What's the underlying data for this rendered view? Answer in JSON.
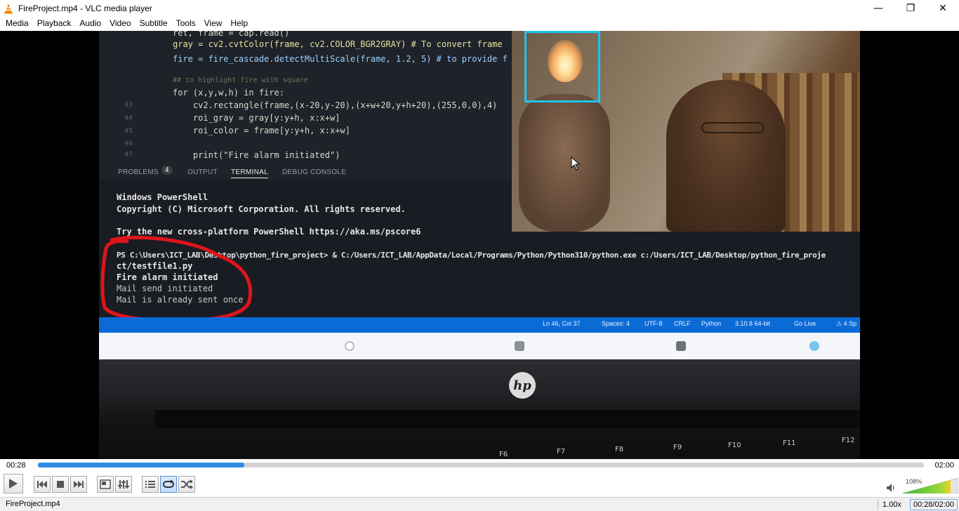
{
  "window": {
    "title": "FireProject.mp4 - VLC media player",
    "min_glyph": "—",
    "max_glyph": "❐",
    "close_glyph": "✕"
  },
  "menu": [
    "Media",
    "Playback",
    "Audio",
    "Video",
    "Subtitle",
    "Tools",
    "View",
    "Help"
  ],
  "video_frame": {
    "code_lines": [
      {
        "num": "",
        "text": "ret, frame = cap.read()"
      },
      {
        "num": "",
        "text": "gray = cv2.cvtColor(frame, cv2.COLOR_BGR2GRAY) # To convert frame"
      },
      {
        "num": "",
        "text": "fire = fire_cascade.detectMultiScale(frame, 1.2, 5) # to provide f"
      },
      {
        "num": "",
        "text": ""
      },
      {
        "num": "",
        "text": "## to highlight fire with square"
      },
      {
        "num": "",
        "text": "for (x,y,w,h) in fire:"
      },
      {
        "num": "43",
        "text": "    cv2.rectangle(frame,(x-20,y-20),(x+w+20,y+h+20),(255,0,0),4)"
      },
      {
        "num": "44",
        "text": "    roi_gray = gray[y:y+h, x:x+w]"
      },
      {
        "num": "45",
        "text": "    roi_color = frame[y:y+h, x:x+w]"
      },
      {
        "num": "46",
        "text": ""
      },
      {
        "num": "47",
        "text": "    print(\"Fire alarm initiated\")"
      }
    ],
    "panel_tabs": {
      "problems": "PROBLEMS",
      "problems_count": "4",
      "output": "OUTPUT",
      "terminal": "TERMINAL",
      "debug": "DEBUG CONSOLE"
    },
    "terminal_lines": [
      {
        "text": "Windows PowerShell",
        "dim": false
      },
      {
        "text": "Copyright (C) Microsoft Corporation. All rights reserved.",
        "dim": false
      },
      {
        "text": "",
        "dim": false
      },
      {
        "text": "Try the new cross-platform PowerShell https://aka.ms/pscore6",
        "dim": false
      },
      {
        "text": "",
        "dim": false
      },
      {
        "text": "PS C:\\Users\\ICT_LAB\\Desktop\\python_fire_project> & C:/Users/ICT_LAB/AppData/Local/Programs/Python/Python310/python.exe c:/Users/ICT_LAB/Desktop/python_fire_proje",
        "dim": false
      },
      {
        "text": "ct/testfile1.py",
        "dim": false
      },
      {
        "text": "Fire alarm initiated",
        "dim": false
      },
      {
        "text": "Mail send initiated",
        "dim": true
      },
      {
        "text": "Mail is already sent once",
        "dim": true
      }
    ],
    "taskbar_items": [
      "Ln 46, Col 37",
      "Spaces: 4",
      "UTF-8",
      "CRLF",
      "Python",
      "3.10.8 64-bit",
      "Go Live",
      "⚠ 4 Sp"
    ],
    "fn_keys": [
      "F6",
      "F7",
      "F8",
      "F9",
      "F10",
      "F11",
      "F12"
    ],
    "brand": "hp"
  },
  "playback": {
    "elapsed": "00:28",
    "total": "02:00",
    "progress": 0.233,
    "volume": "108%",
    "volume_level": 1.08
  },
  "status": {
    "filename": "FireProject.mp4",
    "speed": "1.00x",
    "time": "00:28/02:00"
  }
}
